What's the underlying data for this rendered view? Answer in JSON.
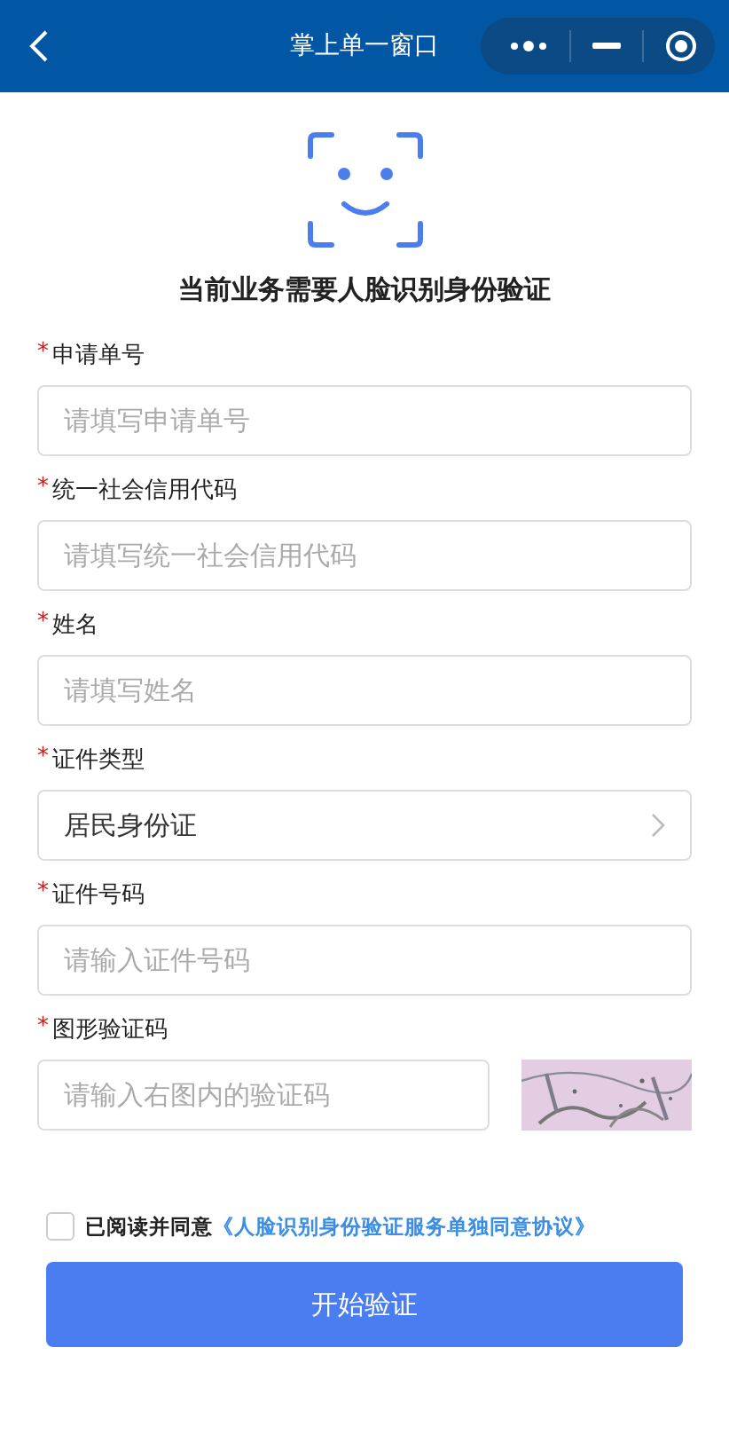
{
  "header": {
    "title": "掌上单一窗口"
  },
  "heading": "当前业务需要人脸识别身份验证",
  "fields": [
    {
      "kind": "input",
      "asterisk": "*",
      "label": "申请单号",
      "placeholder": "请填写申请单号"
    },
    {
      "kind": "input",
      "asterisk": "*",
      "label": "统一社会信用代码",
      "placeholder": "请填写统一社会信用代码"
    },
    {
      "kind": "input",
      "asterisk": "*",
      "label": "姓名",
      "placeholder": "请填写姓名"
    },
    {
      "kind": "select",
      "asterisk": "*",
      "label": "证件类型",
      "value": "居民身份证"
    },
    {
      "kind": "input",
      "asterisk": "*",
      "label": "证件号码",
      "placeholder": "请输入证件号码"
    },
    {
      "kind": "captcha",
      "asterisk": "*",
      "label": "图形验证码",
      "placeholder": "请输入右图内的验证码"
    }
  ],
  "agreement": {
    "checked": false,
    "text": "已阅读并同意",
    "link": "《人脸识别身份验证服务单独同意协议》"
  },
  "submit": "开始验证"
}
